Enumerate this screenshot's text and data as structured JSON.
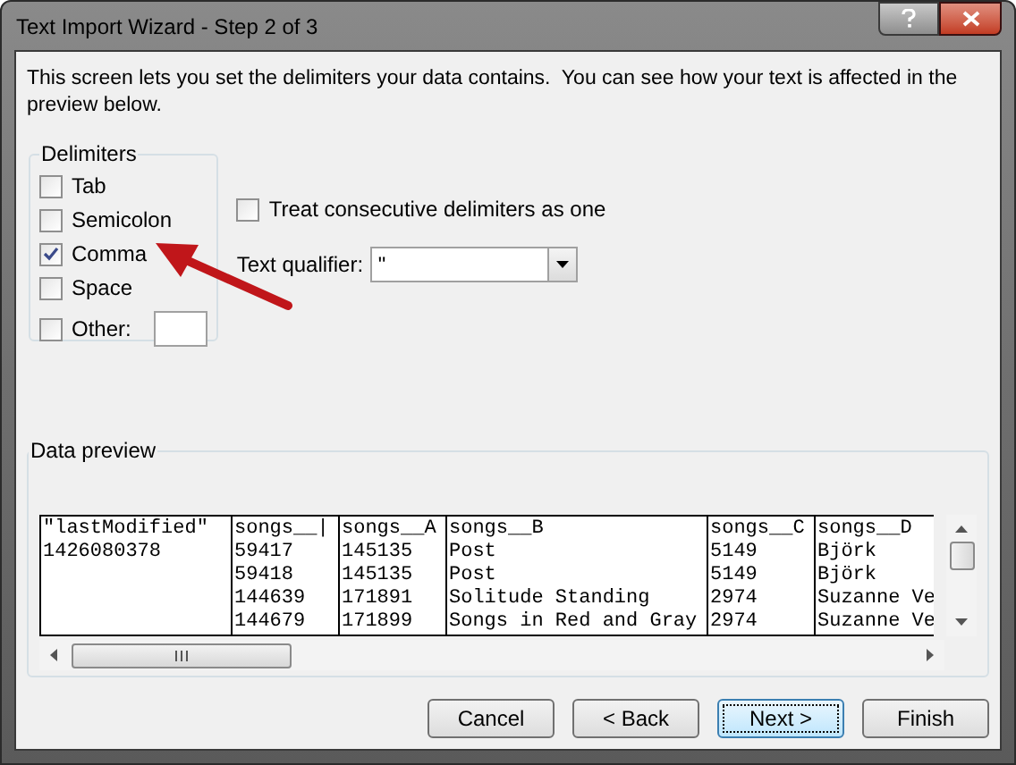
{
  "window": {
    "title": "Text Import Wizard - Step 2 of 3"
  },
  "description": "This screen lets you set the delimiters your data contains.  You can see how your text is affected in the preview below.",
  "delimiters": {
    "title": "Delimiters",
    "options": [
      {
        "label": "Tab",
        "checked": false,
        "kind": "plain"
      },
      {
        "label": "Semicolon",
        "checked": false,
        "kind": "plain"
      },
      {
        "label": "Comma",
        "checked": true,
        "kind": "plain"
      },
      {
        "label": "Space",
        "checked": false,
        "kind": "plain"
      },
      {
        "label": "Other:",
        "checked": false,
        "kind": "with_field"
      }
    ]
  },
  "consecutive": {
    "label": "Treat consecutive delimiters as one",
    "checked": false
  },
  "text_qualifier": {
    "label": "Text qualifier:",
    "value": "\""
  },
  "data_preview": {
    "title": "Data preview",
    "columns": [
      {
        "header": "\"lastModified\"",
        "cells": [
          "1426080378",
          "",
          "",
          ""
        ]
      },
      {
        "header": "songs__|",
        "cells": [
          "59417",
          "59418",
          "144639",
          "144679"
        ]
      },
      {
        "header": "songs__A",
        "cells": [
          "145135",
          "145135",
          "171891",
          "171899"
        ]
      },
      {
        "header": "songs__B",
        "cells": [
          "Post",
          "Post",
          "Solitude Standing",
          "Songs in Red and Gray"
        ]
      },
      {
        "header": "songs__C",
        "cells": [
          "5149",
          "5149",
          "2974",
          "2974"
        ]
      },
      {
        "header": "songs__D",
        "cells": [
          "Björk",
          "Björk",
          "Suzanne Ve",
          "Suzanne Ve"
        ]
      }
    ]
  },
  "buttons": [
    {
      "label": "Cancel",
      "focused": false
    },
    {
      "label": "< Back",
      "focused": false
    },
    {
      "label": "Next >",
      "focused": true
    },
    {
      "label": "Finish",
      "focused": false
    }
  ]
}
